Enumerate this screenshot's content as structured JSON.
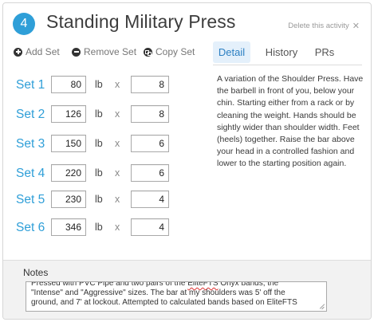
{
  "activity": {
    "number": "4",
    "title": "Standing Military Press",
    "delete_label": "Delete this activity",
    "delete_icon": "close-icon"
  },
  "toolbar": {
    "add_set": "Add Set",
    "remove_set": "Remove Set",
    "copy_set": "Copy Set"
  },
  "tabs": [
    {
      "label": "Detail",
      "active": true
    },
    {
      "label": "History",
      "active": false
    },
    {
      "label": "PRs",
      "active": false
    }
  ],
  "sets": [
    {
      "label": "Set 1",
      "weight": "80",
      "unit": "lb",
      "times": "x",
      "reps": "8"
    },
    {
      "label": "Set 2",
      "weight": "126",
      "unit": "lb",
      "times": "x",
      "reps": "8"
    },
    {
      "label": "Set 3",
      "weight": "150",
      "unit": "lb",
      "times": "x",
      "reps": "6"
    },
    {
      "label": "Set 4",
      "weight": "220",
      "unit": "lb",
      "times": "x",
      "reps": "6"
    },
    {
      "label": "Set 5",
      "weight": "230",
      "unit": "lb",
      "times": "x",
      "reps": "4"
    },
    {
      "label": "Set 6",
      "weight": "346",
      "unit": "lb",
      "times": "x",
      "reps": "4"
    }
  ],
  "detail": {
    "text": "A variation of the Shoulder Press. Have the barbell in front of you, below your chin. Starting either from a rack or by cleaning the weight. Hands should be sightly wider than shoulder width. Feet (heels) together. Raise the bar above your head in a controlled fashion and lower to the starting position again."
  },
  "notes": {
    "label": "Notes",
    "text_before": "Pressed with PVC Pipe and two pairs of the ",
    "text_misspelled": "EliteFTS",
    "text_after": " Onyx bands, the \"Intense\" and \"Aggressive\" sizes.  The bar at my shoulders was 5' off the ground, and 7' at lockout.  Attempted to calculated bands based on EliteFTS"
  },
  "colors": {
    "accent": "#2f9fd8",
    "tab_active_bg": "#e4f0fb",
    "notes_bg": "#f2f2f2"
  }
}
